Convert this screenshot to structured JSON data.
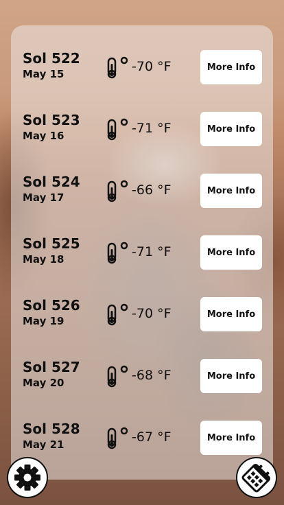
{
  "forecast": {
    "temp_unit": "°F",
    "more_info_label": "More Info",
    "days": [
      {
        "sol": "Sol 522",
        "date": "May 15",
        "temp": "-70 °F"
      },
      {
        "sol": "Sol 523",
        "date": "May 16",
        "temp": "-71 °F"
      },
      {
        "sol": "Sol 524",
        "date": "May 17",
        "temp": "-66 °F"
      },
      {
        "sol": "Sol 525",
        "date": "May 18",
        "temp": "-71 °F"
      },
      {
        "sol": "Sol 526",
        "date": "May 19",
        "temp": "-70 °F"
      },
      {
        "sol": "Sol 527",
        "date": "May 20",
        "temp": "-68 °F"
      },
      {
        "sol": "Sol 528",
        "date": "May 21",
        "temp": "-67 °F"
      }
    ]
  },
  "icons": {
    "temperature": "thermometer-icon",
    "settings": "gear-icon",
    "calendar": "calendar-icon"
  },
  "colors": {
    "panel": "#ebe6e4",
    "button": "#ffffff",
    "text": "#111111"
  }
}
